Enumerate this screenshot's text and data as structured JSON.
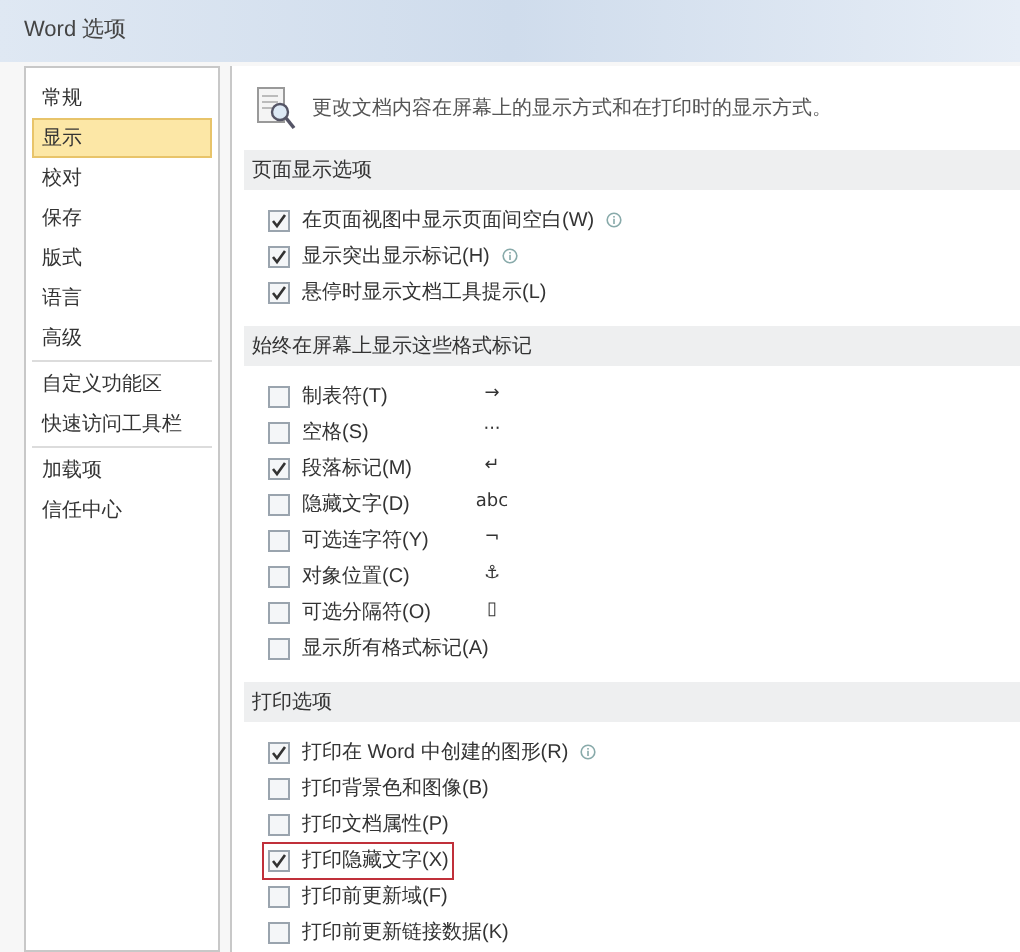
{
  "window": {
    "title": "Word 选项"
  },
  "sidebar": {
    "items": [
      {
        "label": "常规",
        "selected": false,
        "divider_after": false
      },
      {
        "label": "显示",
        "selected": true,
        "divider_after": false
      },
      {
        "label": "校对",
        "selected": false,
        "divider_after": false
      },
      {
        "label": "保存",
        "selected": false,
        "divider_after": false
      },
      {
        "label": "版式",
        "selected": false,
        "divider_after": false
      },
      {
        "label": "语言",
        "selected": false,
        "divider_after": false
      },
      {
        "label": "高级",
        "selected": false,
        "divider_after": true
      },
      {
        "label": "自定义功能区",
        "selected": false,
        "divider_after": false
      },
      {
        "label": "快速访问工具栏",
        "selected": false,
        "divider_after": true
      },
      {
        "label": "加载项",
        "selected": false,
        "divider_after": false
      },
      {
        "label": "信任中心",
        "selected": false,
        "divider_after": false
      }
    ]
  },
  "description": "更改文档内容在屏幕上的显示方式和在打印时的显示方式。",
  "sections": [
    {
      "title": "页面显示选项",
      "options": [
        {
          "label": "在页面视图中显示页面间空白(W)",
          "checked": true,
          "info": true
        },
        {
          "label": "显示突出显示标记(H)",
          "checked": true,
          "info": true
        },
        {
          "label": "悬停时显示文档工具提示(L)",
          "checked": true,
          "info": false
        }
      ]
    },
    {
      "title": "始终在屏幕上显示这些格式标记",
      "options": [
        {
          "label": "制表符(T)",
          "checked": false,
          "symbol": "→"
        },
        {
          "label": "空格(S)",
          "checked": false,
          "symbol": "···"
        },
        {
          "label": "段落标记(M)",
          "checked": true,
          "symbol": "↵"
        },
        {
          "label": "隐藏文字(D)",
          "checked": false,
          "symbol": "abc"
        },
        {
          "label": "可选连字符(Y)",
          "checked": false,
          "symbol": "¬"
        },
        {
          "label": "对象位置(C)",
          "checked": false,
          "symbol": "⚓"
        },
        {
          "label": "可选分隔符(O)",
          "checked": false,
          "symbol": "▯"
        },
        {
          "label": "显示所有格式标记(A)",
          "checked": false
        }
      ]
    },
    {
      "title": "打印选项",
      "options": [
        {
          "label": "打印在 Word 中创建的图形(R)",
          "checked": true,
          "info": true,
          "highlighted": false
        },
        {
          "label": "打印背景色和图像(B)",
          "checked": false,
          "highlighted": false
        },
        {
          "label": "打印文档属性(P)",
          "checked": false,
          "highlighted": false
        },
        {
          "label": "打印隐藏文字(X)",
          "checked": true,
          "highlighted": true
        },
        {
          "label": "打印前更新域(F)",
          "checked": false,
          "highlighted": false
        },
        {
          "label": "打印前更新链接数据(K)",
          "checked": false,
          "highlighted": false
        }
      ]
    }
  ]
}
